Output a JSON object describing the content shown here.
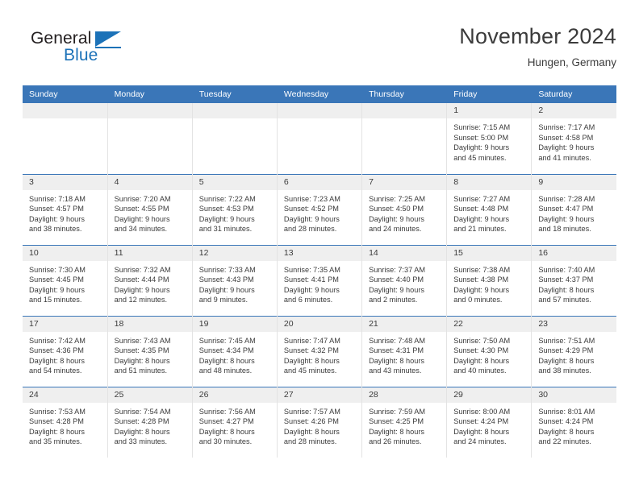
{
  "brand": {
    "name_part1": "General",
    "name_part2": "Blue",
    "accent_color": "#1c72b8"
  },
  "header": {
    "title": "November 2024",
    "subtitle": "Hungen, Germany"
  },
  "theme": {
    "header_blue": "#3a76b8",
    "daynum_band": "#efefef",
    "text": "#3b3b3b",
    "cell_divider": "#e3e3e3"
  },
  "weekday_headers": [
    "Sunday",
    "Monday",
    "Tuesday",
    "Wednesday",
    "Thursday",
    "Friday",
    "Saturday"
  ],
  "weeks": [
    [
      {
        "day": "",
        "empty": true,
        "lines": []
      },
      {
        "day": "",
        "empty": true,
        "lines": []
      },
      {
        "day": "",
        "empty": true,
        "lines": []
      },
      {
        "day": "",
        "empty": true,
        "lines": []
      },
      {
        "day": "",
        "empty": true,
        "lines": []
      },
      {
        "day": "1",
        "empty": false,
        "lines": [
          "Sunrise: 7:15 AM",
          "Sunset: 5:00 PM",
          "Daylight: 9 hours",
          "and 45 minutes."
        ]
      },
      {
        "day": "2",
        "empty": false,
        "lines": [
          "Sunrise: 7:17 AM",
          "Sunset: 4:58 PM",
          "Daylight: 9 hours",
          "and 41 minutes."
        ]
      }
    ],
    [
      {
        "day": "3",
        "empty": false,
        "lines": [
          "Sunrise: 7:18 AM",
          "Sunset: 4:57 PM",
          "Daylight: 9 hours",
          "and 38 minutes."
        ]
      },
      {
        "day": "4",
        "empty": false,
        "lines": [
          "Sunrise: 7:20 AM",
          "Sunset: 4:55 PM",
          "Daylight: 9 hours",
          "and 34 minutes."
        ]
      },
      {
        "day": "5",
        "empty": false,
        "lines": [
          "Sunrise: 7:22 AM",
          "Sunset: 4:53 PM",
          "Daylight: 9 hours",
          "and 31 minutes."
        ]
      },
      {
        "day": "6",
        "empty": false,
        "lines": [
          "Sunrise: 7:23 AM",
          "Sunset: 4:52 PM",
          "Daylight: 9 hours",
          "and 28 minutes."
        ]
      },
      {
        "day": "7",
        "empty": false,
        "lines": [
          "Sunrise: 7:25 AM",
          "Sunset: 4:50 PM",
          "Daylight: 9 hours",
          "and 24 minutes."
        ]
      },
      {
        "day": "8",
        "empty": false,
        "lines": [
          "Sunrise: 7:27 AM",
          "Sunset: 4:48 PM",
          "Daylight: 9 hours",
          "and 21 minutes."
        ]
      },
      {
        "day": "9",
        "empty": false,
        "lines": [
          "Sunrise: 7:28 AM",
          "Sunset: 4:47 PM",
          "Daylight: 9 hours",
          "and 18 minutes."
        ]
      }
    ],
    [
      {
        "day": "10",
        "empty": false,
        "lines": [
          "Sunrise: 7:30 AM",
          "Sunset: 4:45 PM",
          "Daylight: 9 hours",
          "and 15 minutes."
        ]
      },
      {
        "day": "11",
        "empty": false,
        "lines": [
          "Sunrise: 7:32 AM",
          "Sunset: 4:44 PM",
          "Daylight: 9 hours",
          "and 12 minutes."
        ]
      },
      {
        "day": "12",
        "empty": false,
        "lines": [
          "Sunrise: 7:33 AM",
          "Sunset: 4:43 PM",
          "Daylight: 9 hours",
          "and 9 minutes."
        ]
      },
      {
        "day": "13",
        "empty": false,
        "lines": [
          "Sunrise: 7:35 AM",
          "Sunset: 4:41 PM",
          "Daylight: 9 hours",
          "and 6 minutes."
        ]
      },
      {
        "day": "14",
        "empty": false,
        "lines": [
          "Sunrise: 7:37 AM",
          "Sunset: 4:40 PM",
          "Daylight: 9 hours",
          "and 2 minutes."
        ]
      },
      {
        "day": "15",
        "empty": false,
        "lines": [
          "Sunrise: 7:38 AM",
          "Sunset: 4:38 PM",
          "Daylight: 9 hours",
          "and 0 minutes."
        ]
      },
      {
        "day": "16",
        "empty": false,
        "lines": [
          "Sunrise: 7:40 AM",
          "Sunset: 4:37 PM",
          "Daylight: 8 hours",
          "and 57 minutes."
        ]
      }
    ],
    [
      {
        "day": "17",
        "empty": false,
        "lines": [
          "Sunrise: 7:42 AM",
          "Sunset: 4:36 PM",
          "Daylight: 8 hours",
          "and 54 minutes."
        ]
      },
      {
        "day": "18",
        "empty": false,
        "lines": [
          "Sunrise: 7:43 AM",
          "Sunset: 4:35 PM",
          "Daylight: 8 hours",
          "and 51 minutes."
        ]
      },
      {
        "day": "19",
        "empty": false,
        "lines": [
          "Sunrise: 7:45 AM",
          "Sunset: 4:34 PM",
          "Daylight: 8 hours",
          "and 48 minutes."
        ]
      },
      {
        "day": "20",
        "empty": false,
        "lines": [
          "Sunrise: 7:47 AM",
          "Sunset: 4:32 PM",
          "Daylight: 8 hours",
          "and 45 minutes."
        ]
      },
      {
        "day": "21",
        "empty": false,
        "lines": [
          "Sunrise: 7:48 AM",
          "Sunset: 4:31 PM",
          "Daylight: 8 hours",
          "and 43 minutes."
        ]
      },
      {
        "day": "22",
        "empty": false,
        "lines": [
          "Sunrise: 7:50 AM",
          "Sunset: 4:30 PM",
          "Daylight: 8 hours",
          "and 40 minutes."
        ]
      },
      {
        "day": "23",
        "empty": false,
        "lines": [
          "Sunrise: 7:51 AM",
          "Sunset: 4:29 PM",
          "Daylight: 8 hours",
          "and 38 minutes."
        ]
      }
    ],
    [
      {
        "day": "24",
        "empty": false,
        "lines": [
          "Sunrise: 7:53 AM",
          "Sunset: 4:28 PM",
          "Daylight: 8 hours",
          "and 35 minutes."
        ]
      },
      {
        "day": "25",
        "empty": false,
        "lines": [
          "Sunrise: 7:54 AM",
          "Sunset: 4:28 PM",
          "Daylight: 8 hours",
          "and 33 minutes."
        ]
      },
      {
        "day": "26",
        "empty": false,
        "lines": [
          "Sunrise: 7:56 AM",
          "Sunset: 4:27 PM",
          "Daylight: 8 hours",
          "and 30 minutes."
        ]
      },
      {
        "day": "27",
        "empty": false,
        "lines": [
          "Sunrise: 7:57 AM",
          "Sunset: 4:26 PM",
          "Daylight: 8 hours",
          "and 28 minutes."
        ]
      },
      {
        "day": "28",
        "empty": false,
        "lines": [
          "Sunrise: 7:59 AM",
          "Sunset: 4:25 PM",
          "Daylight: 8 hours",
          "and 26 minutes."
        ]
      },
      {
        "day": "29",
        "empty": false,
        "lines": [
          "Sunrise: 8:00 AM",
          "Sunset: 4:24 PM",
          "Daylight: 8 hours",
          "and 24 minutes."
        ]
      },
      {
        "day": "30",
        "empty": false,
        "lines": [
          "Sunrise: 8:01 AM",
          "Sunset: 4:24 PM",
          "Daylight: 8 hours",
          "and 22 minutes."
        ]
      }
    ]
  ]
}
